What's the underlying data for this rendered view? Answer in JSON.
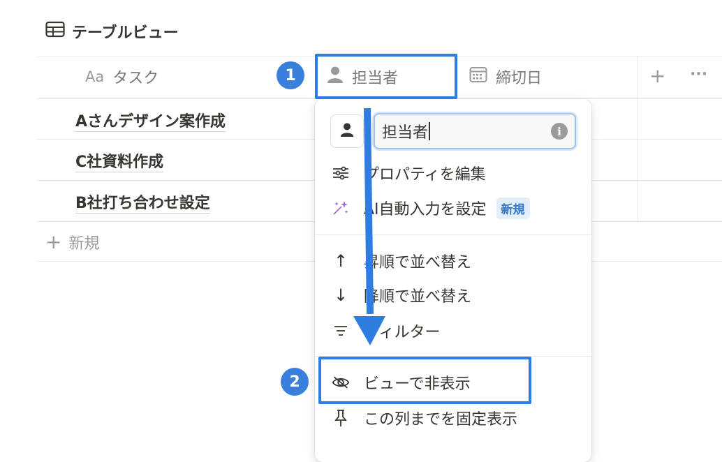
{
  "view": {
    "title": "テーブルビュー",
    "icon": "table-icon"
  },
  "columns": {
    "title": {
      "type_icon": "Aa",
      "label": "タスク"
    },
    "assignee": {
      "label": "担当者",
      "icon": "person-icon"
    },
    "deadline": {
      "label": "締切日",
      "icon": "calendar-icon"
    },
    "add_label": "+",
    "more_label": "···"
  },
  "rows": [
    {
      "title": "Aさんデザイン案作成"
    },
    {
      "title": "C社資料作成"
    },
    {
      "title": "B社打ち合わせ設定"
    }
  ],
  "new_row": {
    "icon": "+",
    "label": "新規"
  },
  "property_menu": {
    "name_value": "担当者",
    "info_icon": "i",
    "items": [
      {
        "label": "プロパティを編集",
        "icon": "sliders-icon"
      },
      {
        "label": "AI自動入力を設定",
        "icon": "sparkle-icon",
        "badge": "新規"
      },
      {
        "label": "昇順で並べ替え",
        "icon": "arrow-up-icon",
        "glyph": "↑"
      },
      {
        "label": "降順で並べ替え",
        "icon": "arrow-down-icon",
        "glyph": "↓"
      },
      {
        "label": "フィルター",
        "icon": "filter-icon"
      },
      {
        "label": "ビューで非表示",
        "icon": "eye-off-icon"
      },
      {
        "label": "この列までを固定表示",
        "icon": "pin-icon"
      }
    ]
  },
  "annotations": {
    "step1": "1",
    "step2": "2",
    "color": "#2f7de1"
  }
}
